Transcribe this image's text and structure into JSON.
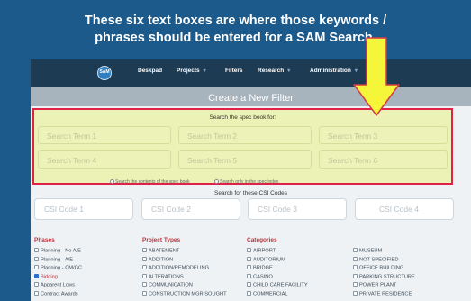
{
  "caption": {
    "line1": "These six text boxes are where those keywords /",
    "line2": "phrases should be entered for a SAM Search."
  },
  "nav": {
    "logo_text": "SAM",
    "items": [
      {
        "label": "Deskpad",
        "dropdown": false
      },
      {
        "label": "Projects",
        "dropdown": true
      },
      {
        "label": "Filters",
        "dropdown": false
      },
      {
        "label": "Research",
        "dropdown": true
      },
      {
        "label": "Administration",
        "dropdown": true
      }
    ],
    "caret": "▾"
  },
  "page_title": "Create a New Filter",
  "spec": {
    "heading": "Search the spec book for:",
    "terms": [
      "Search Term 1",
      "Search Term 2",
      "Search Term 3",
      "Search Term 4",
      "Search Term 5",
      "Search Term 6"
    ],
    "radio_contents": "Search the contents of the spec book",
    "radio_index": "Search only in the spec index"
  },
  "csi": {
    "heading": "Search for these CSI Codes",
    "codes": [
      "CSI Code 1",
      "CSI Code 2",
      "CSI Code 3",
      "CSI Code 4"
    ]
  },
  "phases": {
    "heading": "Phases",
    "items": [
      {
        "label": "Planning - No A/E",
        "checked": false
      },
      {
        "label": "Planning - A/E",
        "checked": false
      },
      {
        "label": "Planning - CM/GC",
        "checked": false
      },
      {
        "label": "Bidding",
        "checked": true
      },
      {
        "label": "Apparent Lows",
        "checked": false
      },
      {
        "label": "Contract Awards",
        "checked": false
      }
    ]
  },
  "project_types": {
    "heading": "Project Types",
    "items": [
      {
        "label": "ABATEMENT",
        "checked": false
      },
      {
        "label": "ADDITION",
        "checked": false
      },
      {
        "label": "ADDITION/REMODELING",
        "checked": false
      },
      {
        "label": "ALTERATIONS",
        "checked": false
      },
      {
        "label": "COMMUNICATION",
        "checked": false
      },
      {
        "label": "CONSTRUCTION MGR SOUGHT",
        "checked": false
      }
    ]
  },
  "categories": {
    "heading": "Categories",
    "col1": [
      {
        "label": "AIRPORT",
        "checked": false
      },
      {
        "label": "AUDITORIUM",
        "checked": false
      },
      {
        "label": "BRIDGE",
        "checked": false
      },
      {
        "label": "CASINO",
        "checked": false
      },
      {
        "label": "CHILD CARE FACILITY",
        "checked": false
      },
      {
        "label": "COMMERCIAL",
        "checked": false
      }
    ],
    "col2": [
      {
        "label": "MUSEUM",
        "checked": false
      },
      {
        "label": "NOT SPECIFIED",
        "checked": false
      },
      {
        "label": "OFFICE BUILDING",
        "checked": false
      },
      {
        "label": "PARKING STRUCTURE",
        "checked": false
      },
      {
        "label": "POWER PLANT",
        "checked": false
      },
      {
        "label": "PRIVATE RESIDENCE",
        "checked": false
      }
    ]
  },
  "colors": {
    "background": "#1b5a8a",
    "highlight": "#ecf2b6",
    "highlight_border": "#e0214a",
    "arrow_fill": "#f5f53a",
    "arrow_stroke": "#d43a4a",
    "nav_bg": "#1e3b54",
    "heading_red": "#c2313a"
  },
  "icons": {
    "arrow": "down-arrow-icon",
    "checkbox": "checkbox-icon",
    "radio": "radio-icon"
  }
}
